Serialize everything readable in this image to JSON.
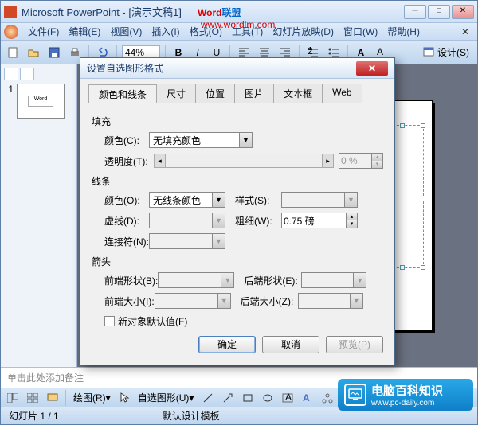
{
  "app": {
    "title": "Microsoft PowerPoint - [演示文稿1]",
    "watermark_text1": "Word",
    "watermark_text2": "联盟",
    "watermark_url": "www.wordlm.com"
  },
  "menu": {
    "file": "文件(F)",
    "edit": "编辑(E)",
    "view": "视图(V)",
    "insert": "插入(I)",
    "format": "格式(O)",
    "tools": "工具(T)",
    "slideshow": "幻灯片放映(D)",
    "window": "窗口(W)",
    "help": "帮助(H)"
  },
  "toolbar": {
    "zoom": "44%",
    "design": "设计(S)"
  },
  "thumb": {
    "num": "1",
    "text": "Word"
  },
  "notes": {
    "placeholder": "单击此处添加备注"
  },
  "drawbar": {
    "draw": "绘图(R)",
    "autoshape": "自选图形(U)"
  },
  "status": {
    "slide": "幻灯片 1 / 1",
    "template": "默认设计模板"
  },
  "dialog": {
    "title": "设置自选图形格式",
    "tabs": {
      "colorsLines": "颜色和线条",
      "size": "尺寸",
      "position": "位置",
      "picture": "图片",
      "textbox": "文本框",
      "web": "Web"
    },
    "fill": {
      "group": "填充",
      "color_lbl": "颜色(C):",
      "color_val": "无填充颜色",
      "trans_lbl": "透明度(T):",
      "trans_val": "0 %"
    },
    "line": {
      "group": "线条",
      "color_lbl": "颜色(O):",
      "color_val": "无线条颜色",
      "style_lbl": "样式(S):",
      "dash_lbl": "虚线(D):",
      "weight_lbl": "粗细(W):",
      "weight_val": "0.75 磅",
      "connector_lbl": "连接符(N):"
    },
    "arrows": {
      "group": "箭头",
      "beginStyle_lbl": "前端形状(B):",
      "endStyle_lbl": "后端形状(E):",
      "beginSize_lbl": "前端大小(I):",
      "endSize_lbl": "后端大小(Z):"
    },
    "defaults_chk": "新对象默认值(F)",
    "ok": "确定",
    "cancel": "取消",
    "preview": "预览(P)"
  },
  "bottom_watermark": {
    "text1": "电脑百科知识",
    "text2": "www.pc-daily.com"
  }
}
